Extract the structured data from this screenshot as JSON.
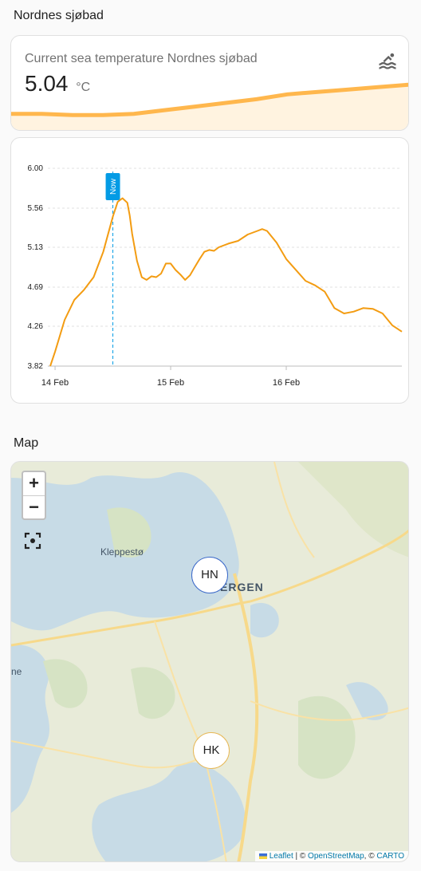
{
  "sections": {
    "top_title": "Nordnes sjøbad",
    "map_title": "Map"
  },
  "sensor": {
    "name": "Current sea temperature Nordnes sjøbad",
    "value": "5.04",
    "unit": "°C",
    "icon": "swim-icon",
    "accent_color": "#ffb74d"
  },
  "chart_data": {
    "type": "line",
    "title": "",
    "xlabel": "",
    "ylabel": "",
    "ylim": [
      3.82,
      6.0
    ],
    "y_ticks": [
      "6.00",
      "5.56",
      "5.13",
      "4.69",
      "4.26",
      "3.82"
    ],
    "x_ticks": [
      {
        "label": "14 Feb",
        "x": 0
      },
      {
        "label": "15 Feb",
        "x": 24
      },
      {
        "label": "16 Feb",
        "x": 48
      }
    ],
    "now_marker": {
      "label": "Now",
      "x": 12
    },
    "grid": true,
    "series": [
      {
        "color": "#f39c12",
        "x": [
          -1,
          0,
          2,
          4,
          6,
          8,
          10,
          12,
          13,
          14,
          15,
          15.5,
          16,
          17,
          18,
          19,
          20,
          21,
          22,
          23,
          24,
          25,
          26,
          27,
          28,
          29,
          30,
          31,
          32,
          33,
          34,
          36,
          38,
          40,
          42,
          43,
          44,
          46,
          48,
          50,
          52,
          54,
          56,
          58,
          60,
          62,
          64,
          66,
          68,
          70,
          72
        ],
        "y": [
          3.82,
          3.98,
          4.33,
          4.55,
          4.66,
          4.8,
          5.08,
          5.47,
          5.63,
          5.67,
          5.62,
          5.48,
          5.28,
          4.98,
          4.8,
          4.77,
          4.81,
          4.8,
          4.84,
          4.95,
          4.95,
          4.88,
          4.83,
          4.77,
          4.82,
          4.91,
          5.0,
          5.08,
          5.1,
          5.09,
          5.13,
          5.17,
          5.2,
          5.27,
          5.31,
          5.33,
          5.31,
          5.18,
          5.0,
          4.88,
          4.76,
          4.71,
          4.64,
          4.46,
          4.4,
          4.42,
          4.46,
          4.45,
          4.4,
          4.27,
          4.2
        ]
      }
    ]
  },
  "sparkline": {
    "values": [
      5.0,
      5.0,
      4.99,
      4.99,
      5.0,
      5.03,
      5.06,
      5.09,
      5.12,
      5.16,
      5.18,
      5.2,
      5.22,
      5.24
    ]
  },
  "map": {
    "zoom_in": "+",
    "zoom_out": "−",
    "place_labels": [
      "Kleppestø",
      "ERGEN",
      "ne"
    ],
    "markers": [
      {
        "label": "HN",
        "color": "#3b69c9"
      },
      {
        "label": "HK",
        "color": "#e7b857"
      }
    ],
    "attribution": {
      "leaflet": "Leaflet",
      "sep": " | © ",
      "osm": "OpenStreetMap",
      "comma": ", © ",
      "carto": "CARTO"
    }
  }
}
